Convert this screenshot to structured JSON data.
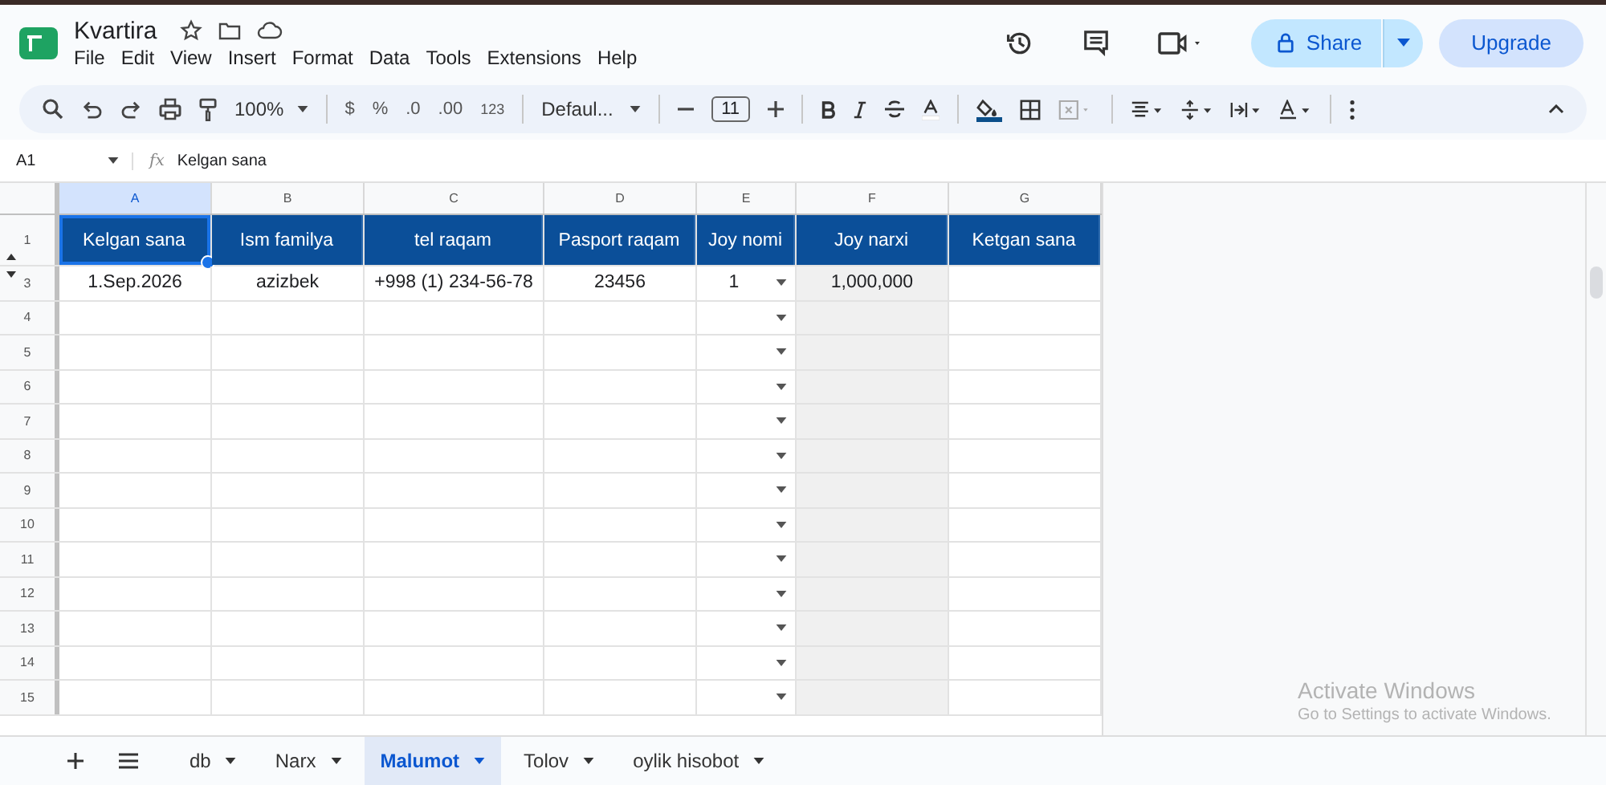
{
  "doc": {
    "title": "Kvartira",
    "menu": [
      "File",
      "Edit",
      "View",
      "Insert",
      "Format",
      "Data",
      "Tools",
      "Extensions",
      "Help"
    ],
    "share": "Share",
    "upgrade": "Upgrade"
  },
  "toolbar": {
    "zoom": "100%",
    "currency": "$",
    "percent": "%",
    "dec_less": ".0",
    "dec_more": ".00",
    "number_format": "123",
    "font": "Defaul...",
    "font_size": "11"
  },
  "formula_bar": {
    "cell": "A1",
    "fx": "fx",
    "value": "Kelgan sana"
  },
  "grid": {
    "columns": [
      {
        "letter": "A",
        "selected": true,
        "shaded": false
      },
      {
        "letter": "B",
        "selected": false,
        "shaded": false
      },
      {
        "letter": "C",
        "selected": false,
        "shaded": false
      },
      {
        "letter": "D",
        "selected": false,
        "shaded": false
      },
      {
        "letter": "E",
        "selected": false,
        "shaded": false
      },
      {
        "letter": "F",
        "selected": false,
        "shaded": true
      },
      {
        "letter": "G",
        "selected": false,
        "shaded": false
      }
    ],
    "rows": [
      {
        "number": "1",
        "kind": "header",
        "cells": [
          "Kelgan sana",
          "Ism familya",
          "tel raqam",
          "Pasport raqam",
          "Joy nomi",
          "Joy narxi",
          "Ketgan sana"
        ]
      },
      {
        "number": "3",
        "kind": "data",
        "dropdown": true,
        "cells": [
          "1.Sep.2026",
          "azizbek",
          "+998 (1) 234-56-78",
          "23456",
          "1",
          "1,000,000"
        ]
      },
      {
        "number": "4",
        "kind": "data",
        "dropdown": true
      },
      {
        "number": "5",
        "kind": "data",
        "dropdown": true
      },
      {
        "number": "6",
        "kind": "data",
        "dropdown": true
      },
      {
        "number": "7",
        "kind": "data",
        "dropdown": true
      },
      {
        "number": "8",
        "kind": "data",
        "dropdown": true
      },
      {
        "number": "9",
        "kind": "data",
        "dropdown": true
      },
      {
        "number": "10",
        "kind": "data",
        "dropdown": true
      },
      {
        "number": "11",
        "kind": "data",
        "dropdown": true
      },
      {
        "number": "12",
        "kind": "data",
        "dropdown": true
      },
      {
        "number": "13",
        "kind": "data",
        "dropdown": true
      },
      {
        "number": "14",
        "kind": "data",
        "dropdown": true
      },
      {
        "number": "15",
        "kind": "data",
        "dropdown": true
      }
    ]
  },
  "sheets": [
    {
      "name": "db",
      "selected": false
    },
    {
      "name": "Narx",
      "selected": false
    },
    {
      "name": "Malumot",
      "selected": true
    },
    {
      "name": "Tolov",
      "selected": false
    },
    {
      "name": "oylik hisobot",
      "selected": false
    }
  ],
  "os_notice": {
    "title": "Activate Windows",
    "text": "Go to Settings to activate Windows."
  }
}
